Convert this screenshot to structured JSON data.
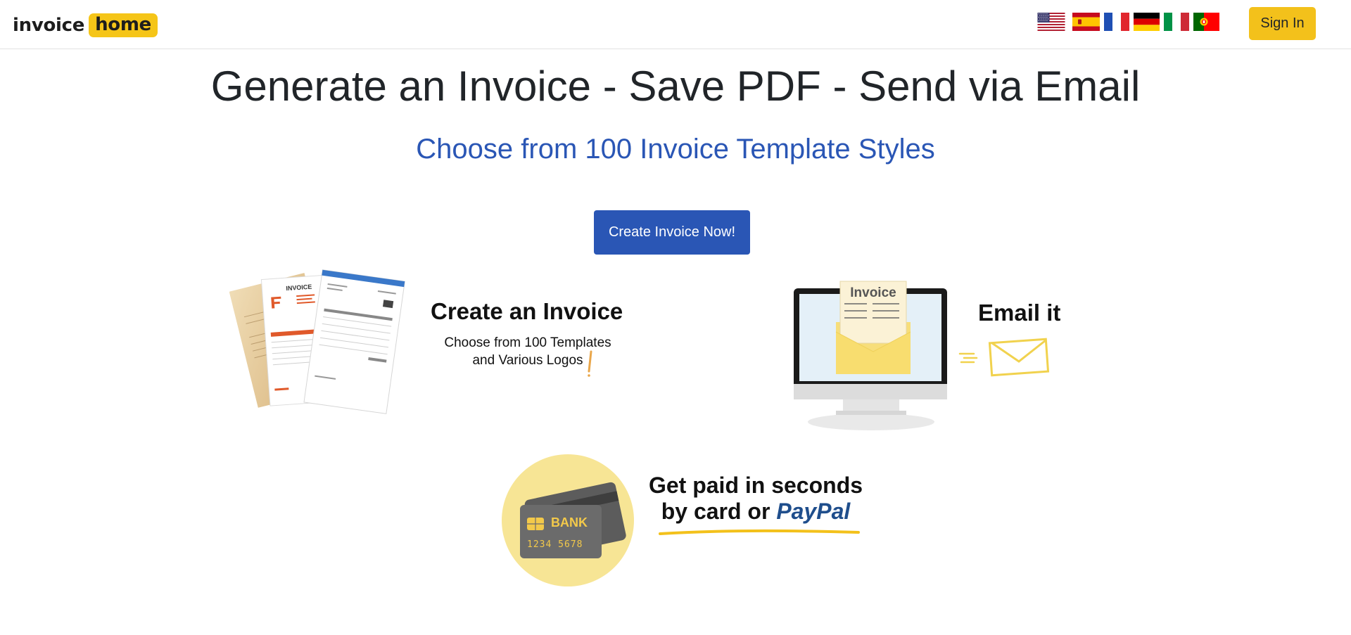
{
  "header": {
    "logo_word_1": "invoice",
    "logo_word_2": "home",
    "languages": [
      {
        "code": "en-US",
        "name": "United States flag"
      },
      {
        "code": "es",
        "name": "Spain flag"
      },
      {
        "code": "fr",
        "name": "France flag"
      },
      {
        "code": "de",
        "name": "Germany flag"
      },
      {
        "code": "it",
        "name": "Italy flag"
      },
      {
        "code": "pt",
        "name": "Portugal flag"
      }
    ],
    "sign_in_label": "Sign In"
  },
  "hero": {
    "title": "Generate an Invoice - Save PDF - Send via Email",
    "subtitle": "Choose from 100 Invoice Template Styles",
    "cta_label": "Create Invoice Now!"
  },
  "features": {
    "create": {
      "title": "Create an Invoice",
      "desc_line_1": "Choose from 100 Templates",
      "desc_line_2": "and Various Logos",
      "doc_label": "INVOICE"
    },
    "email": {
      "title": "Email it",
      "screen_label": "Invoice"
    },
    "paid": {
      "title_line_1": "Get paid in seconds",
      "title_line_2_prefix": "by card or ",
      "title_line_2_brand": "PayPal",
      "card_bank_label": "BANK",
      "card_number": "1234 5678"
    }
  },
  "colors": {
    "brand_yellow": "#f3c11b",
    "primary_blue": "#2a56b5",
    "paypal_blue": "#1f4e8c"
  }
}
